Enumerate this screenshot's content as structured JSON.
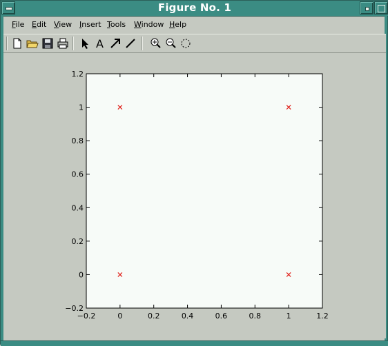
{
  "window": {
    "title": "Figure No. 1"
  },
  "menu": {
    "items": [
      {
        "label": "File",
        "u": "F",
        "rest": "ile"
      },
      {
        "label": "Edit",
        "u": "E",
        "rest": "dit"
      },
      {
        "label": "View",
        "u": "V",
        "rest": "iew"
      },
      {
        "label": "Insert",
        "u": "I",
        "rest": "nsert"
      },
      {
        "label": "Tools",
        "u": "T",
        "rest": "ools"
      },
      {
        "label": "Window",
        "u": "W",
        "rest": "indow"
      },
      {
        "label": "Help",
        "u": "H",
        "rest": "elp"
      }
    ]
  },
  "toolbar": {
    "tools": [
      "new-file-icon",
      "open-folder-icon",
      "save-icon",
      "print-icon",
      "select-arrow-icon",
      "text-icon",
      "arrow-icon",
      "line-icon",
      "zoom-in-icon",
      "zoom-out-icon",
      "rotate-icon"
    ]
  },
  "chart_data": {
    "type": "scatter",
    "title": "",
    "xlabel": "",
    "ylabel": "",
    "xlim": [
      -0.2,
      1.2
    ],
    "ylim": [
      -0.2,
      1.2
    ],
    "xticks": [
      "−0.2",
      "0",
      "0.2",
      "0.4",
      "0.6",
      "0.8",
      "1",
      "1.2"
    ],
    "yticks": [
      "−0.2",
      "0",
      "0.2",
      "0.4",
      "0.6",
      "0.8",
      "1",
      "1.2"
    ],
    "grid": false,
    "marker": "x",
    "marker_color": "#e0201a",
    "series": [
      {
        "x": [
          0,
          1,
          0,
          1
        ],
        "y": [
          1,
          1,
          0,
          0
        ]
      }
    ]
  }
}
